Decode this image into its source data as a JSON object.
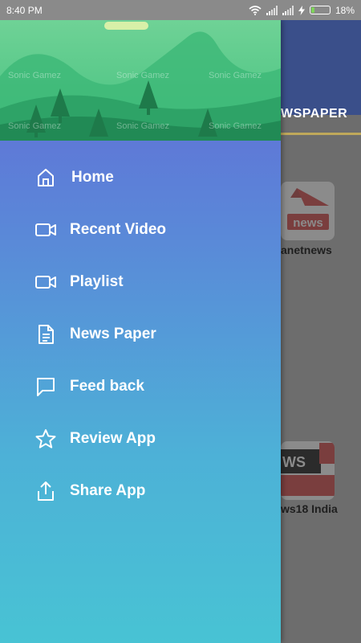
{
  "status_bar": {
    "time": "8:40 PM",
    "battery_text": "18%",
    "battery_level": 0.18
  },
  "app": {
    "tab_label": "WSPAPER",
    "cards": [
      {
        "label": "anetnews",
        "logo_text": "news"
      },
      {
        "label": "ws18 India",
        "logo_text": "WS"
      }
    ]
  },
  "drawer": {
    "header_watermark": "Sonic Gamez",
    "menu": [
      {
        "label": "Home",
        "icon": "home-icon"
      },
      {
        "label": "Recent Video",
        "icon": "video-camera-icon"
      },
      {
        "label": "Playlist",
        "icon": "video-camera-icon"
      },
      {
        "label": "News Paper",
        "icon": "document-icon"
      },
      {
        "label": "Feed back",
        "icon": "chat-bubble-icon"
      },
      {
        "label": "Review App",
        "icon": "star-icon"
      },
      {
        "label": "Share App",
        "icon": "share-icon"
      }
    ]
  },
  "colors": {
    "drawer_top": "#6366d6",
    "drawer_bottom": "#48c3d4",
    "accent": "#bfa85a"
  }
}
